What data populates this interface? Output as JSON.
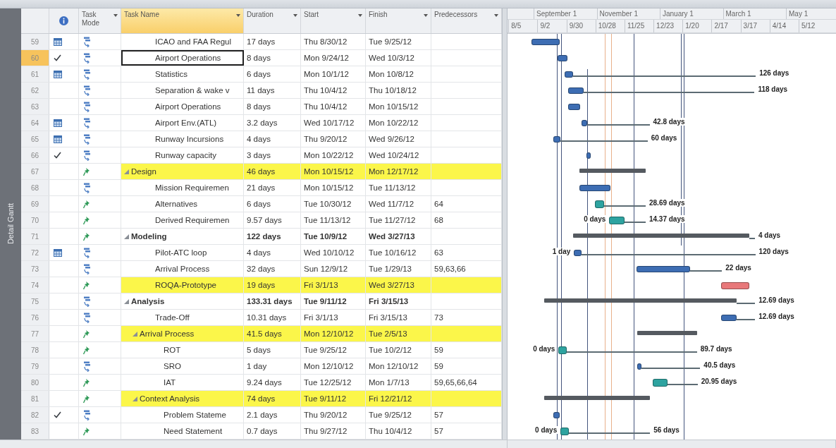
{
  "view_bar": {
    "label": "Detail Gantt"
  },
  "columns": [
    {
      "kind": "icon",
      "selected": false
    },
    {
      "kind": "text",
      "label": "Task Mode",
      "selected": false
    },
    {
      "kind": "text",
      "label": "Task Name",
      "selected": true
    },
    {
      "kind": "text",
      "label": "Duration",
      "selected": false
    },
    {
      "kind": "text",
      "label": "Start",
      "selected": false
    },
    {
      "kind": "text",
      "label": "Finish",
      "selected": false
    },
    {
      "kind": "text",
      "label": "Predecessors",
      "selected": false
    }
  ],
  "timescale": {
    "months": [
      "September 1",
      "November 1",
      "January 1",
      "March 1",
      "May 1"
    ],
    "weeks": [
      "8/5",
      "9/2",
      "9/30",
      "10/28",
      "11/25",
      "12/23",
      "1/20",
      "2/17",
      "3/17",
      "4/14",
      "5/12"
    ]
  },
  "rows": [
    {
      "id": "59",
      "constrained": true,
      "complete": false,
      "manual": false,
      "name": "ICAO and FAA Regul",
      "duration": "17 days",
      "start": "Thu 8/30/12",
      "finish": "Tue 9/25/12",
      "selected": false,
      "highlighted": false
    },
    {
      "id": "60",
      "constrained": false,
      "complete": true,
      "manual": false,
      "name": "Airport Operations",
      "duration": "8 days",
      "start": "Mon 9/24/12",
      "finish": "Wed 10/3/12",
      "selected": true,
      "highlighted": false
    },
    {
      "id": "61",
      "constrained": true,
      "complete": false,
      "manual": false,
      "name": "Statistics",
      "duration": "6 days",
      "start": "Mon 10/1/12",
      "finish": "Mon 10/8/12",
      "selected": false,
      "highlighted": false,
      "right_label": "126 days"
    },
    {
      "id": "62",
      "constrained": false,
      "complete": false,
      "manual": false,
      "name": "Separation & wake v",
      "duration": "11 days",
      "start": "Thu 10/4/12",
      "finish": "Thu 10/18/12",
      "selected": false,
      "highlighted": false,
      "right_label": "118 days"
    },
    {
      "id": "63",
      "constrained": false,
      "complete": false,
      "manual": false,
      "name": "Airport Operations",
      "duration": "8 days",
      "start": "Thu 10/4/12",
      "finish": "Mon 10/15/12",
      "selected": false,
      "highlighted": false
    },
    {
      "id": "64",
      "constrained": true,
      "complete": false,
      "manual": false,
      "name": "Airport Env.(ATL)",
      "duration": "3.2 days",
      "start": "Wed 10/17/12",
      "finish": "Mon 10/22/12",
      "selected": false,
      "highlighted": false,
      "right_label": "42.8 days"
    },
    {
      "id": "65",
      "constrained": true,
      "complete": false,
      "manual": false,
      "name": "Runway Incursions",
      "duration": "4 days",
      "start": "Thu 9/20/12",
      "finish": "Wed 9/26/12",
      "selected": false,
      "highlighted": false,
      "right_label": "60 days"
    },
    {
      "id": "66",
      "constrained": false,
      "complete": true,
      "manual": false,
      "name": "Runway capacity",
      "duration": "3 days",
      "start": "Mon 10/22/12",
      "finish": "Wed 10/24/12",
      "selected": false,
      "highlighted": false
    },
    {
      "id": "67",
      "constrained": false,
      "complete": false,
      "manual": true,
      "name": "Design",
      "duration": "46 days",
      "start": "Mon 10/15/12",
      "finish": "Mon 12/17/12",
      "selected": false,
      "highlighted": true,
      "expanded": true,
      "children": [
        {
          "id": "68",
          "constrained": false,
          "complete": false,
          "manual": false,
          "name": "Mission Requiremen",
          "duration": "21 days",
          "start": "Mon 10/15/12",
          "finish": "Tue 11/13/12",
          "selected": false,
          "highlighted": false
        },
        {
          "id": "69",
          "constrained": false,
          "complete": false,
          "manual": true,
          "name": "Alternatives",
          "duration": "6 days",
          "start": "Tue 10/30/12",
          "finish": "Wed 11/7/12",
          "predecessors": "64",
          "selected": false,
          "highlighted": false,
          "right_label": "28.69 days"
        },
        {
          "id": "70",
          "constrained": false,
          "complete": false,
          "manual": true,
          "name": "Derived Requiremen",
          "duration": "9.57 days",
          "start": "Tue 11/13/12",
          "finish": "Tue 11/27/12",
          "predecessors": "68",
          "selected": false,
          "highlighted": false,
          "left_label": "0 days",
          "right_label": "14.37 days"
        }
      ]
    },
    {
      "id": "71",
      "constrained": false,
      "complete": false,
      "manual": true,
      "name": "Modeling",
      "duration": "122 days",
      "start": "Tue 10/9/12",
      "finish": "Wed 3/27/13",
      "selected": false,
      "highlighted": false,
      "expanded": true,
      "right_label": "4 days",
      "children": [
        {
          "id": "72",
          "constrained": true,
          "complete": false,
          "manual": false,
          "name": "Pilot-ATC loop",
          "duration": "4 days",
          "start": "Wed 10/10/12",
          "finish": "Tue 10/16/12",
          "predecessors": "63",
          "selected": false,
          "highlighted": false,
          "left_label": "1 day",
          "right_label": "120 days"
        },
        {
          "id": "73",
          "constrained": false,
          "complete": false,
          "manual": false,
          "name": "Arrival Process",
          "duration": "32 days",
          "start": "Sun 12/9/12",
          "finish": "Tue 1/29/13",
          "predecessors": "59,63,66",
          "selected": false,
          "highlighted": false,
          "right_label": "22 days"
        },
        {
          "id": "74",
          "constrained": false,
          "complete": false,
          "manual": true,
          "name": "ROQA-Prototype",
          "duration": "19 days",
          "start": "Fri 3/1/13",
          "finish": "Wed 3/27/13",
          "selected": false,
          "highlighted": true
        }
      ]
    },
    {
      "id": "75",
      "constrained": false,
      "complete": false,
      "manual": false,
      "name": "Analysis",
      "duration": "133.31 days",
      "start": "Tue 9/11/12",
      "finish": "Fri 3/15/13",
      "selected": false,
      "highlighted": false,
      "expanded": true,
      "right_label": "12.69 days",
      "children": [
        {
          "id": "76",
          "constrained": false,
          "complete": false,
          "manual": false,
          "name": "Trade-Off",
          "duration": "10.31 days",
          "start": "Fri 3/1/13",
          "finish": "Fri 3/15/13",
          "predecessors": "73",
          "selected": false,
          "highlighted": false,
          "right_label": "12.69 days"
        },
        {
          "id": "77",
          "constrained": false,
          "complete": false,
          "manual": true,
          "name": "Arrival Process",
          "duration": "41.5 days",
          "start": "Mon 12/10/12",
          "finish": "Tue 2/5/13",
          "selected": false,
          "highlighted": true,
          "expanded": true,
          "children": [
            {
              "id": "78",
              "constrained": false,
              "complete": false,
              "manual": true,
              "name": "ROT",
              "duration": "5 days",
              "start": "Tue 9/25/12",
              "finish": "Tue 10/2/12",
              "predecessors": "59",
              "selected": false,
              "highlighted": false,
              "left_label": "0 days",
              "right_label": "89.7 days"
            },
            {
              "id": "79",
              "constrained": false,
              "complete": false,
              "manual": false,
              "name": "SRO",
              "duration": "1 day",
              "start": "Mon 12/10/12",
              "finish": "Mon 12/10/12",
              "predecessors": "59",
              "selected": false,
              "highlighted": false,
              "right_label": "40.5 days"
            },
            {
              "id": "80",
              "constrained": false,
              "complete": false,
              "manual": true,
              "name": "IAT",
              "duration": "9.24 days",
              "start": "Tue 12/25/12",
              "finish": "Mon 1/7/13",
              "predecessors": "59,65,66,64",
              "selected": false,
              "highlighted": false,
              "right_label": "20.95 days"
            }
          ]
        },
        {
          "id": "81",
          "constrained": false,
          "complete": false,
          "manual": true,
          "name": "Context Analysis",
          "duration": "74 days",
          "start": "Tue 9/11/12",
          "finish": "Fri 12/21/12",
          "selected": false,
          "highlighted": true,
          "expanded": true,
          "children": [
            {
              "id": "82",
              "constrained": false,
              "complete": true,
              "manual": false,
              "name": "Problem Stateme",
              "duration": "2.1 days",
              "start": "Thu 9/20/12",
              "finish": "Tue 9/25/12",
              "predecessors": "57",
              "selected": false,
              "highlighted": false
            },
            {
              "id": "83",
              "constrained": false,
              "complete": false,
              "manual": true,
              "name": "Need Statement",
              "duration": "0.7 days",
              "start": "Thu 9/27/12",
              "finish": "Thu 10/4/12",
              "predecessors": "57",
              "selected": false,
              "highlighted": false,
              "left_label": "0 days",
              "right_label": "56 days"
            }
          ]
        }
      ]
    }
  ]
}
